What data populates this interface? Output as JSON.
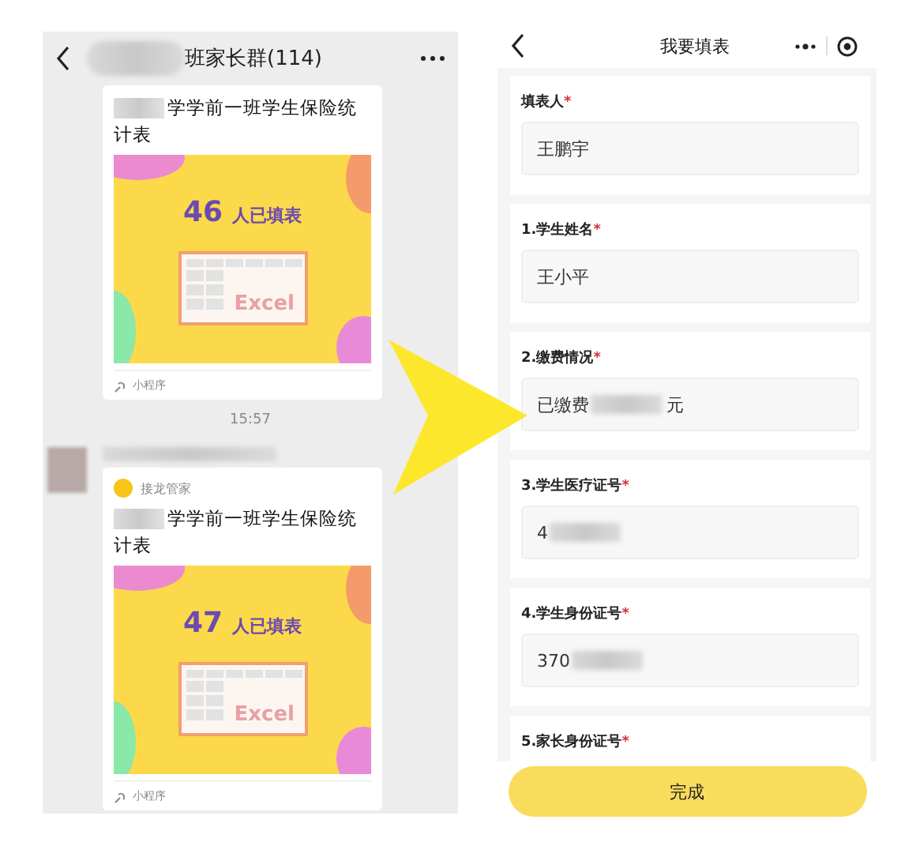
{
  "chat": {
    "header": {
      "title": "班家长群(114)"
    },
    "messages": [
      {
        "kind": "card",
        "title": "学学前一班学生保险统计表",
        "count": "46",
        "count_label": "人已填表",
        "sheet_label": "Excel",
        "footer": "小程序"
      },
      {
        "kind": "time",
        "text": "15:57"
      },
      {
        "kind": "card",
        "avatar": true,
        "app": "接龙管家",
        "title": "学学前一班学生保险统计表",
        "count": "47",
        "count_label": "人已填表",
        "sheet_label": "Excel",
        "footer": "小程序"
      }
    ]
  },
  "form": {
    "header": {
      "title": "我要填表"
    },
    "questions": [
      {
        "label": "填表人",
        "mark": "*",
        "value": "王鹏宇"
      },
      {
        "label": "1.学生姓名",
        "mark": "*",
        "value": "王小平"
      },
      {
        "label": "2.缴费情况",
        "mark": "*",
        "value": "已缴费",
        "redacted": true,
        "value_after": "元"
      },
      {
        "label": "3.学生医疗证号",
        "mark": "*",
        "value": "4",
        "redacted": true
      },
      {
        "label": "4.学生身份证号",
        "mark": "*",
        "value": "370",
        "redacted": true
      },
      {
        "label": "5.家长身份证号",
        "mark": "*"
      }
    ],
    "submit": "完成"
  }
}
